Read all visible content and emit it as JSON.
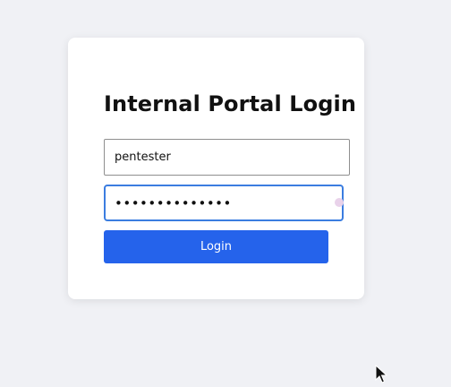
{
  "login": {
    "title": "Internal Portal Login",
    "username_value": "pentester",
    "password_value": "••••••••••••••",
    "button_label": "Login"
  },
  "colors": {
    "page_background": "#f0f1f5",
    "card_background": "#ffffff",
    "primary_button": "#2563eb",
    "focus_border": "#3b7de0"
  },
  "icons": {
    "password_manager_badge": "password-manager-icon",
    "mouse_cursor": "mouse-pointer-icon"
  }
}
